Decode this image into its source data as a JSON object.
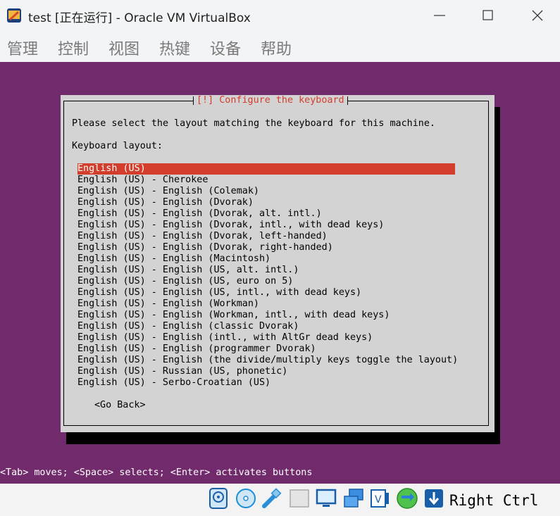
{
  "window": {
    "title": "test [正在运行] - Oracle VM VirtualBox",
    "app_icon": "virtualbox-icon",
    "controls": [
      "minimize-icon",
      "maximize-icon",
      "close-icon"
    ]
  },
  "menu": {
    "items": [
      "管理",
      "控制",
      "视图",
      "热键",
      "设备",
      "帮助"
    ]
  },
  "installer": {
    "dialog_title": "[!] Configure the keyboard",
    "prompt": "Please select the layout matching the keyboard for this machine.",
    "list_label": "Keyboard layout:",
    "layouts": [
      "English (US)",
      "English (US) - Cherokee",
      "English (US) - English (Colemak)",
      "English (US) - English (Dvorak)",
      "English (US) - English (Dvorak, alt. intl.)",
      "English (US) - English (Dvorak, intl., with dead keys)",
      "English (US) - English (Dvorak, left-handed)",
      "English (US) - English (Dvorak, right-handed)",
      "English (US) - English (Macintosh)",
      "English (US) - English (US, alt. intl.)",
      "English (US) - English (US, euro on 5)",
      "English (US) - English (US, intl., with dead keys)",
      "English (US) - English (Workman)",
      "English (US) - English (Workman, intl., with dead keys)",
      "English (US) - English (classic Dvorak)",
      "English (US) - English (intl., with AltGr dead keys)",
      "English (US) - English (programmer Dvorak)",
      "English (US) - English (the divide/multiply keys toggle the layout)",
      "English (US) - Russian (US, phonetic)",
      "English (US) - Serbo-Croatian (US)"
    ],
    "selected_index": 0,
    "go_back_label": "<Go Back>",
    "help_line": "<Tab> moves; <Space> selects; <Enter> activates buttons"
  },
  "statusbar": {
    "icons": [
      "hard-disk-icon",
      "optical-disk-icon",
      "usb-icon",
      "shared-folder-icon",
      "display-icon",
      "network-icon",
      "video-capture-icon",
      "mouse-integration-icon",
      "keyboard-capture-icon"
    ],
    "host_key": "Right Ctrl"
  },
  "colors": {
    "guest_background": "#712a6b",
    "dialog_background": "#d3d3d3",
    "accent": "#d33d2b"
  }
}
